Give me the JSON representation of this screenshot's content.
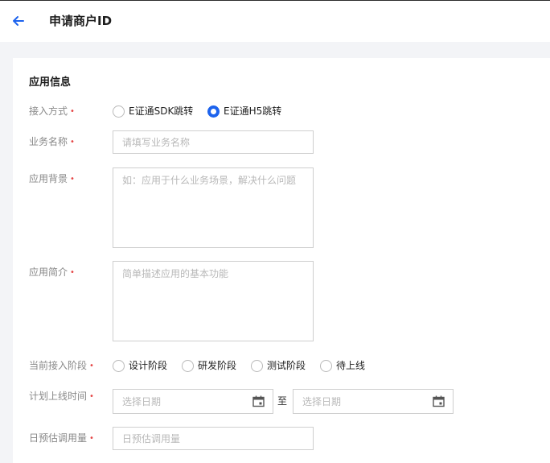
{
  "header": {
    "title": "申请商户ID"
  },
  "form": {
    "section_title": "应用信息",
    "required_mark": "•",
    "access_method": {
      "label": "接入方式",
      "options": [
        {
          "label": "E证通SDK跳转",
          "checked": false
        },
        {
          "label": "E证通H5跳转",
          "checked": true
        }
      ]
    },
    "business_name": {
      "label": "业务名称",
      "placeholder": "请填写业务名称",
      "value": ""
    },
    "app_background": {
      "label": "应用背景",
      "placeholder": "如：应用于什么业务场景，解决什么问题",
      "value": ""
    },
    "app_intro": {
      "label": "应用简介",
      "placeholder": "简单描述应用的基本功能",
      "value": ""
    },
    "current_stage": {
      "label": "当前接入阶段",
      "options": [
        {
          "label": "设计阶段",
          "checked": false
        },
        {
          "label": "研发阶段",
          "checked": false
        },
        {
          "label": "测试阶段",
          "checked": false
        },
        {
          "label": "待上线",
          "checked": false
        }
      ]
    },
    "launch_time": {
      "label": "计划上线时间",
      "start_placeholder": "选择日期",
      "separator": "至",
      "end_placeholder": "选择日期"
    },
    "daily_volume": {
      "label": "日预估调用量",
      "placeholder": "日预估调用量",
      "value": ""
    }
  },
  "colors": {
    "accent": "#1d63ed",
    "required": "#e54545",
    "background": "#f3f4f7"
  }
}
